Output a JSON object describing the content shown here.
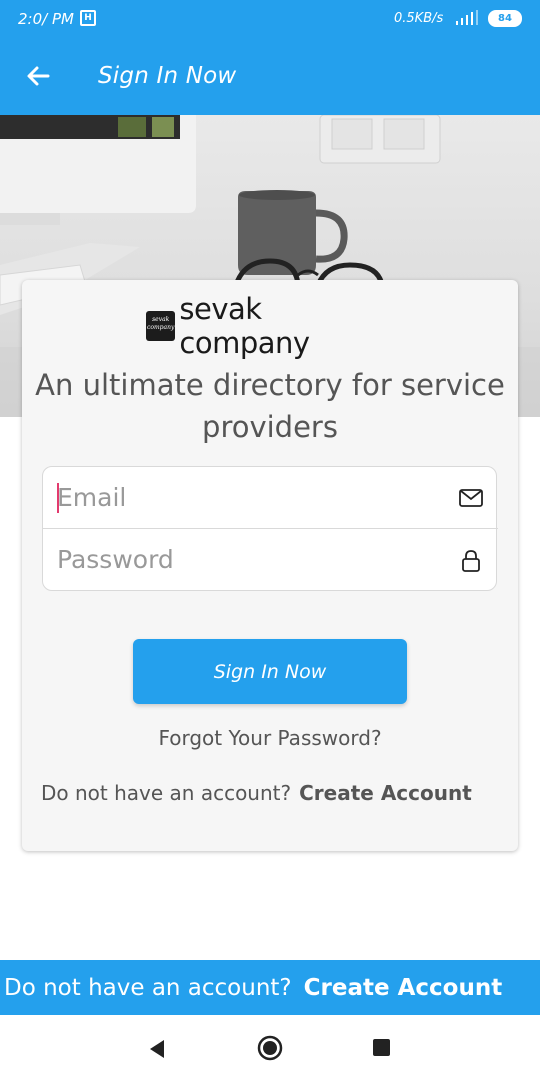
{
  "status_bar": {
    "time": "2:0/ PM",
    "sim_glyph": "H",
    "network_speed": "0.5KB/s",
    "battery": "84",
    "icons": [
      "sim-icon",
      "signal-icon",
      "battery-icon"
    ]
  },
  "app_bar": {
    "title": "Sign In Now",
    "back_icon": "arrow-left-icon"
  },
  "logo": {
    "mark_text": "sevak company",
    "text": "sevak company"
  },
  "tagline": "An ultimate directory for service providers",
  "form": {
    "email": {
      "value": "",
      "placeholder": "Email",
      "icon": "mail-icon"
    },
    "password": {
      "value": "",
      "placeholder": "Password",
      "icon": "lock-icon"
    }
  },
  "actions": {
    "sign_in_label": "Sign In Now",
    "forgot_label": "Forgot Your Password?",
    "no_account_text": "Do not have an account?",
    "create_account_label": "Create Account"
  },
  "bottom_banner": {
    "text": "Do not have an account?",
    "link": "Create Account"
  },
  "nav_bar": {
    "icons": [
      "nav-back-icon",
      "nav-home-icon",
      "nav-recents-icon"
    ]
  },
  "colors": {
    "accent": "#24a0ed",
    "caret": "#e23b6e",
    "card_bg": "#f6f6f6",
    "text_muted": "#555555"
  }
}
